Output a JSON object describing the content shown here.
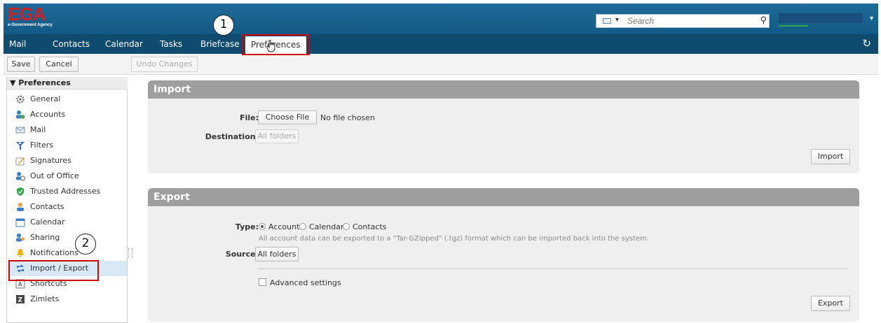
{
  "brand": {
    "name": "EGA",
    "subtitle": "e-Government Agency"
  },
  "search": {
    "placeholder": "Search"
  },
  "tabs": [
    "Mail",
    "Contacts",
    "Calendar",
    "Tasks",
    "Briefcase",
    "Preferences"
  ],
  "active_tab": "Preferences",
  "toolbar": {
    "save": "Save",
    "cancel": "Cancel",
    "undo": "Undo Changes"
  },
  "sidebar": {
    "header": "Preferences",
    "items": [
      {
        "label": "General",
        "icon": "gear-icon"
      },
      {
        "label": "Accounts",
        "icon": "accounts-icon"
      },
      {
        "label": "Mail",
        "icon": "envelope-icon"
      },
      {
        "label": "Filters",
        "icon": "filter-icon"
      },
      {
        "label": "Signatures",
        "icon": "signature-icon"
      },
      {
        "label": "Out of Office",
        "icon": "out-of-office-icon"
      },
      {
        "label": "Trusted Addresses",
        "icon": "shield-check-icon"
      },
      {
        "label": "Contacts",
        "icon": "contact-person-icon"
      },
      {
        "label": "Calendar",
        "icon": "calendar-icon"
      },
      {
        "label": "Sharing",
        "icon": "sharing-icon"
      },
      {
        "label": "Notifications",
        "icon": "bell-icon"
      },
      {
        "label": "Import / Export",
        "icon": "import-export-icon"
      },
      {
        "label": "Shortcuts",
        "icon": "keyboard-key-icon"
      },
      {
        "label": "Zimlets",
        "icon": "zimlet-icon"
      }
    ],
    "selected": "Import / Export"
  },
  "import": {
    "title": "Import",
    "file_label": "File:",
    "choose_file": "Choose File",
    "no_file": "No file chosen",
    "destination_label": "Destination:",
    "destination_value": "All folders",
    "import_button": "Import"
  },
  "export": {
    "title": "Export",
    "type_label": "Type:",
    "types": [
      "Account",
      "Calendar",
      "Contacts"
    ],
    "selected_type": "Account",
    "hint": "All account data can be exported to a \"Tar-GZipped\" (.tgz) format which can be imported back into the system.",
    "source_label": "Source:",
    "source_value": "All folders",
    "advanced": "Advanced settings",
    "export_button": "Export"
  },
  "annotations": {
    "step1": "1",
    "step2": "2"
  },
  "colors": {
    "header": "#1a6391",
    "nav": "#0f4a6f",
    "callout": "#d40000",
    "panel_head": "#9e9e9e"
  }
}
